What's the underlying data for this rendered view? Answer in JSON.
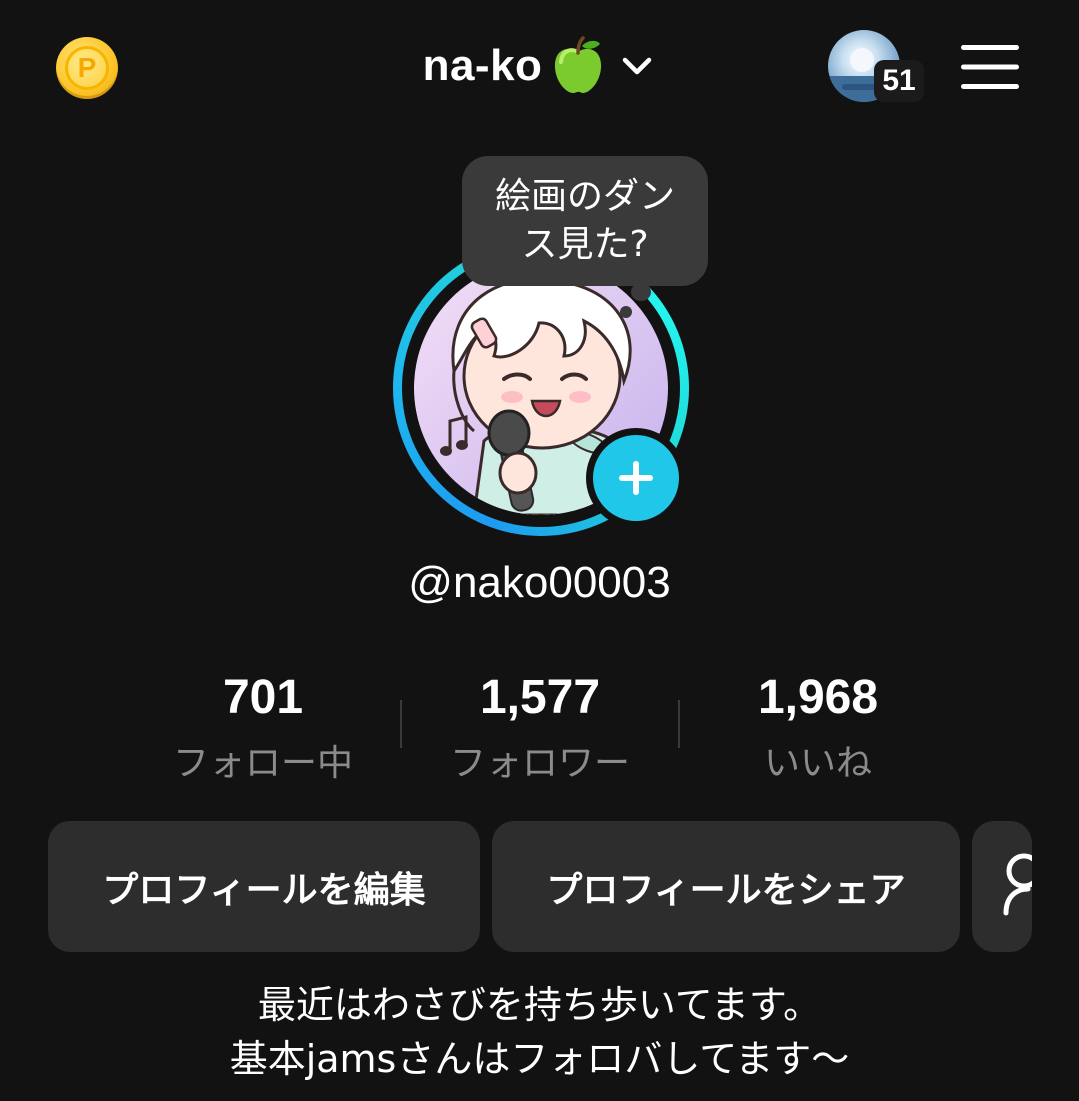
{
  "header": {
    "coin_label": "P",
    "title": "na-ko",
    "title_emoji": "green-apple",
    "story_count": "51"
  },
  "profile": {
    "bubble_text": "絵画のダンス見た?",
    "username": "@nako00003",
    "bio_line1": "最近はわさびを持ち歩いてます。",
    "bio_line2": "基本jamsさんはフォロバしてます〜"
  },
  "stats": [
    {
      "value": "701",
      "label": "フォロー中"
    },
    {
      "value": "1,577",
      "label": "フォロワー"
    },
    {
      "value": "1,968",
      "label": "いいね"
    }
  ],
  "actions": {
    "edit_profile": "プロフィールを編集",
    "share_profile": "プロフィールをシェア",
    "add_friends_icon": "person-add-icon"
  },
  "colors": {
    "background": "#121212",
    "accent_cyan": "#20c7e8",
    "button_bg": "#2d2d2d",
    "muted_text": "#8b8b8b",
    "coin_gold": "#fcc72c"
  }
}
